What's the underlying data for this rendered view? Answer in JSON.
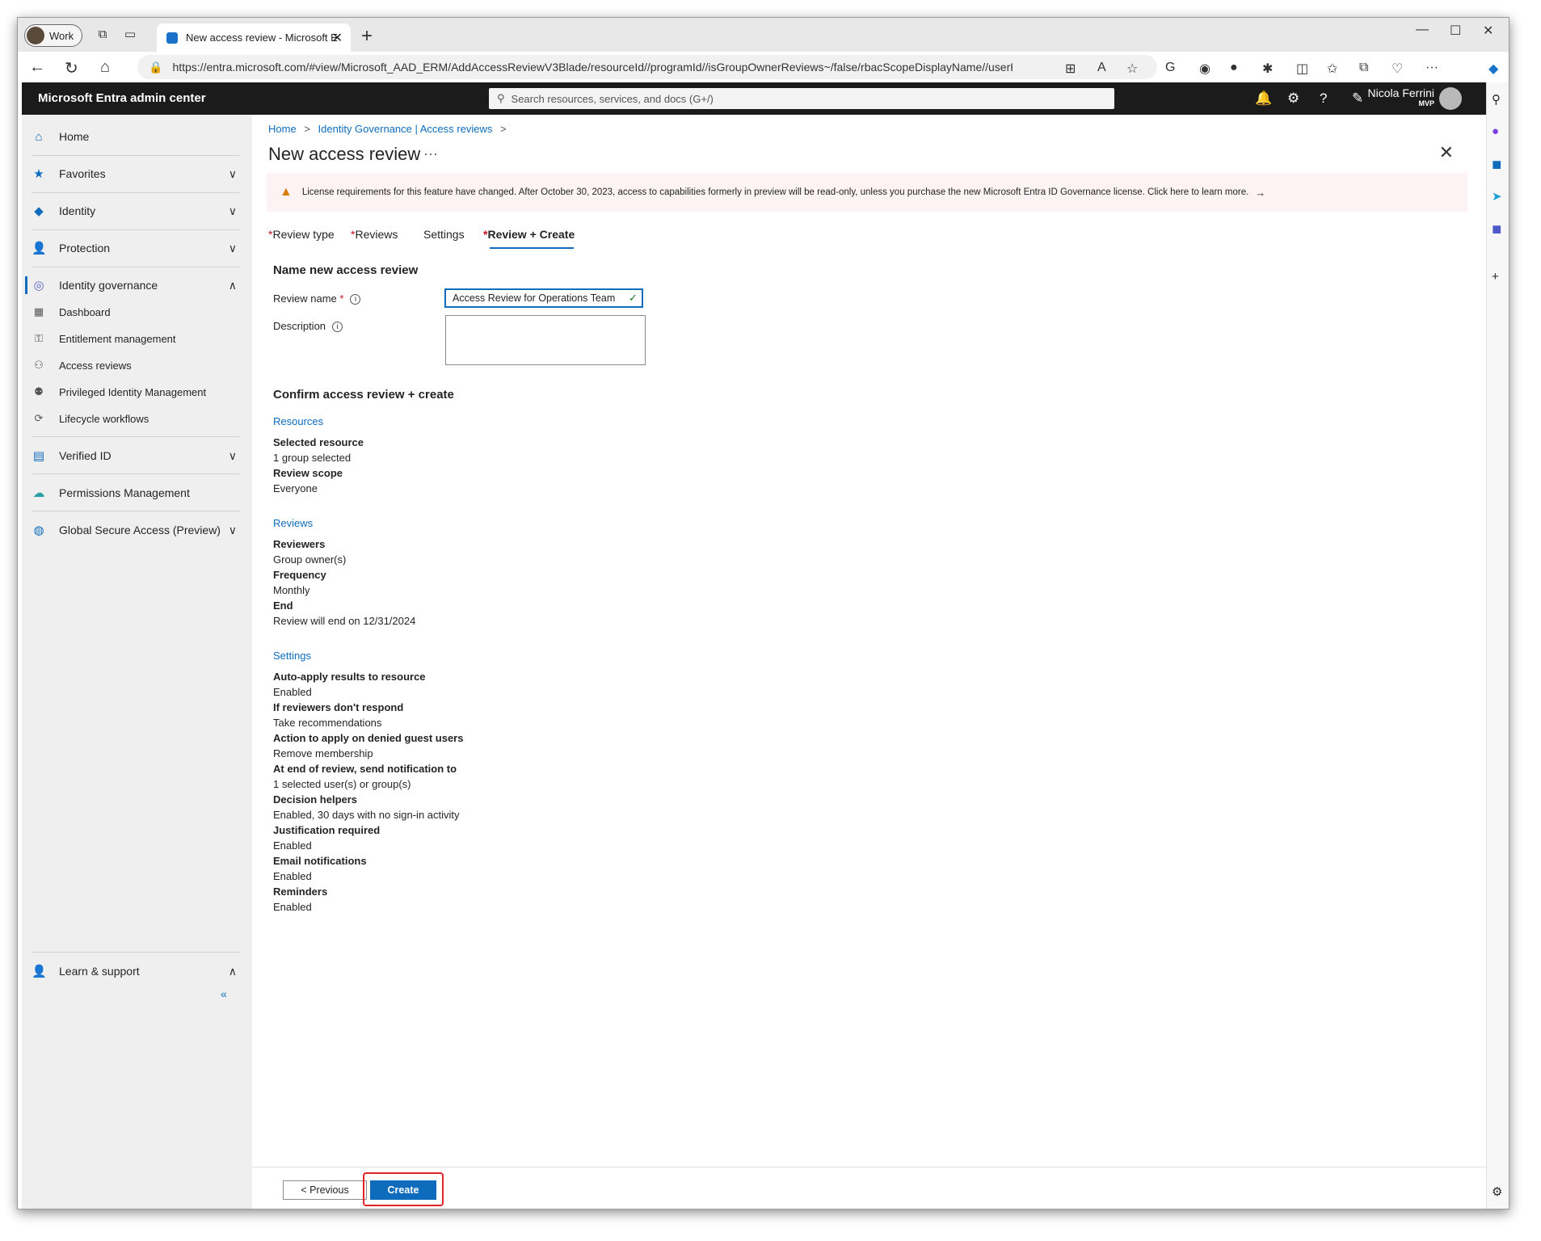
{
  "browser": {
    "profile_label": "Work",
    "tab_title": "New access review - Microsoft E",
    "url": "https://entra.microsoft.com/#view/Microsoft_AAD_ERM/AddAccessReviewV3Blade/resourceId//programId//isGroupOwnerReviews~/false/rbacScopeDisplayName//userHasl..."
  },
  "header": {
    "brand": "Microsoft Entra admin center",
    "search_placeholder": "Search resources, services, and docs (G+/)",
    "user_name": "Nicola Ferrini",
    "user_badge": "MVP"
  },
  "nav": {
    "home": "Home",
    "favorites": "Favorites",
    "identity": "Identity",
    "protection": "Protection",
    "identity_governance": "Identity governance",
    "dashboard": "Dashboard",
    "entitlement": "Entitlement management",
    "access_reviews": "Access reviews",
    "pim": "Privileged Identity Management",
    "lifecycle": "Lifecycle workflows",
    "verified_id": "Verified ID",
    "permissions": "Permissions Management",
    "gsa": "Global Secure Access (Preview)",
    "learn": "Learn & support",
    "collapse": "«"
  },
  "breadcrumb": {
    "home": "Home",
    "sep": ">",
    "governance": "Identity Governance | Access reviews"
  },
  "page": {
    "title": "New access review",
    "more": "···",
    "banner": "License requirements for this feature have changed. After October 30, 2023, access to capabilities formerly in preview will be read-only, unless you purchase the new Microsoft Entra ID Governance license. Click here to learn more.",
    "tabs": [
      "Review type",
      "Reviews",
      "Settings",
      "Review + Create"
    ],
    "name_section": "Name new access review",
    "review_name_label": "Review name",
    "review_name_value": "Access Review for Operations Team",
    "description_label": "Description",
    "confirm_section": "Confirm access review + create"
  },
  "summary": {
    "resources_title": "Resources",
    "resources": [
      {
        "k": "Selected resource",
        "v": "1 group selected"
      },
      {
        "k": "Review scope",
        "v": "Everyone"
      }
    ],
    "reviews_title": "Reviews",
    "reviews": [
      {
        "k": "Reviewers",
        "v": "Group owner(s)"
      },
      {
        "k": "Frequency",
        "v": "Monthly"
      },
      {
        "k": "End",
        "v": "Review will end on 12/31/2024"
      }
    ],
    "settings_title": "Settings",
    "settings": [
      {
        "k": "Auto-apply results to resource",
        "v": "Enabled"
      },
      {
        "k": "If reviewers don't respond",
        "v": "Take recommendations"
      },
      {
        "k": "Action to apply on denied guest users",
        "v": "Remove membership"
      },
      {
        "k": "At end of review, send notification to",
        "v": "1 selected user(s) or group(s)"
      },
      {
        "k": "Decision helpers",
        "v": "Enabled, 30 days with no sign-in activity"
      },
      {
        "k": "Justification required",
        "v": "Enabled"
      },
      {
        "k": "Email notifications",
        "v": "Enabled"
      },
      {
        "k": "Reminders",
        "v": "Enabled"
      }
    ]
  },
  "footer": {
    "previous": "< Previous",
    "create": "Create"
  },
  "colors": {
    "accent": "#0f6cbd",
    "header_bg": "#1b1b1b",
    "required": "#c50f1f",
    "highlight": "#e0242a"
  }
}
